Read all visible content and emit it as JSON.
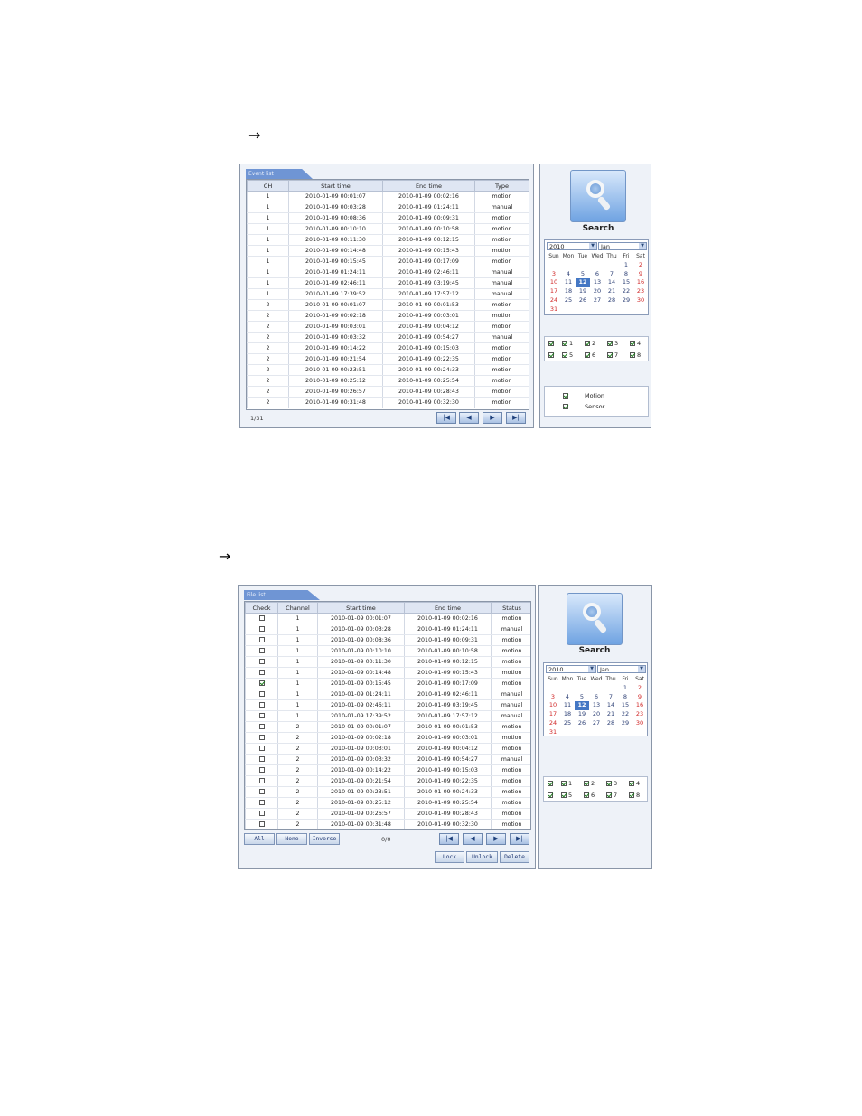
{
  "arrows": {
    "first": "→",
    "second": "→"
  },
  "event_panel": {
    "tab": "Event list",
    "columns": [
      "CH",
      "Start time",
      "End time",
      "Type"
    ],
    "rows": [
      [
        "1",
        "2010-01-09 00:01:07",
        "2010-01-09 00:02:16",
        "motion"
      ],
      [
        "1",
        "2010-01-09 00:03:28",
        "2010-01-09 01:24:11",
        "manual"
      ],
      [
        "1",
        "2010-01-09 00:08:36",
        "2010-01-09 00:09:31",
        "motion"
      ],
      [
        "1",
        "2010-01-09 00:10:10",
        "2010-01-09 00:10:58",
        "motion"
      ],
      [
        "1",
        "2010-01-09 00:11:30",
        "2010-01-09 00:12:15",
        "motion"
      ],
      [
        "1",
        "2010-01-09 00:14:48",
        "2010-01-09 00:15:43",
        "motion"
      ],
      [
        "1",
        "2010-01-09 00:15:45",
        "2010-01-09 00:17:09",
        "motion"
      ],
      [
        "1",
        "2010-01-09 01:24:11",
        "2010-01-09 02:46:11",
        "manual"
      ],
      [
        "1",
        "2010-01-09 02:46:11",
        "2010-01-09 03:19:45",
        "manual"
      ],
      [
        "1",
        "2010-01-09 17:39:52",
        "2010-01-09 17:57:12",
        "manual"
      ],
      [
        "2",
        "2010-01-09 00:01:07",
        "2010-01-09 00:01:53",
        "motion"
      ],
      [
        "2",
        "2010-01-09 00:02:18",
        "2010-01-09 00:03:01",
        "motion"
      ],
      [
        "2",
        "2010-01-09 00:03:01",
        "2010-01-09 00:04:12",
        "motion"
      ],
      [
        "2",
        "2010-01-09 00:03:32",
        "2010-01-09 00:54:27",
        "manual"
      ],
      [
        "2",
        "2010-01-09 00:14:22",
        "2010-01-09 00:15:03",
        "motion"
      ],
      [
        "2",
        "2010-01-09 00:21:54",
        "2010-01-09 00:22:35",
        "motion"
      ],
      [
        "2",
        "2010-01-09 00:23:51",
        "2010-01-09 00:24:33",
        "motion"
      ],
      [
        "2",
        "2010-01-09 00:25:12",
        "2010-01-09 00:25:54",
        "motion"
      ],
      [
        "2",
        "2010-01-09 00:26:57",
        "2010-01-09 00:28:43",
        "motion"
      ],
      [
        "2",
        "2010-01-09 00:31:48",
        "2010-01-09 00:32:30",
        "motion"
      ]
    ],
    "page": "1/31"
  },
  "file_panel": {
    "tab": "File list",
    "columns": [
      "Check",
      "Channel",
      "Start time",
      "End time",
      "Status"
    ],
    "rows": [
      [
        false,
        "1",
        "2010-01-09 00:01:07",
        "2010-01-09 00:02:16",
        "motion"
      ],
      [
        false,
        "1",
        "2010-01-09 00:03:28",
        "2010-01-09 01:24:11",
        "manual"
      ],
      [
        false,
        "1",
        "2010-01-09 00:08:36",
        "2010-01-09 00:09:31",
        "motion"
      ],
      [
        false,
        "1",
        "2010-01-09 00:10:10",
        "2010-01-09 00:10:58",
        "motion"
      ],
      [
        false,
        "1",
        "2010-01-09 00:11:30",
        "2010-01-09 00:12:15",
        "motion"
      ],
      [
        false,
        "1",
        "2010-01-09 00:14:48",
        "2010-01-09 00:15:43",
        "motion"
      ],
      [
        true,
        "1",
        "2010-01-09 00:15:45",
        "2010-01-09 00:17:09",
        "motion"
      ],
      [
        false,
        "1",
        "2010-01-09 01:24:11",
        "2010-01-09 02:46:11",
        "manual"
      ],
      [
        false,
        "1",
        "2010-01-09 02:46:11",
        "2010-01-09 03:19:45",
        "manual"
      ],
      [
        false,
        "1",
        "2010-01-09 17:39:52",
        "2010-01-09 17:57:12",
        "manual"
      ],
      [
        false,
        "2",
        "2010-01-09 00:01:07",
        "2010-01-09 00:01:53",
        "motion"
      ],
      [
        false,
        "2",
        "2010-01-09 00:02:18",
        "2010-01-09 00:03:01",
        "motion"
      ],
      [
        false,
        "2",
        "2010-01-09 00:03:01",
        "2010-01-09 00:04:12",
        "motion"
      ],
      [
        false,
        "2",
        "2010-01-09 00:03:32",
        "2010-01-09 00:54:27",
        "manual"
      ],
      [
        false,
        "2",
        "2010-01-09 00:14:22",
        "2010-01-09 00:15:03",
        "motion"
      ],
      [
        false,
        "2",
        "2010-01-09 00:21:54",
        "2010-01-09 00:22:35",
        "motion"
      ],
      [
        false,
        "2",
        "2010-01-09 00:23:51",
        "2010-01-09 00:24:33",
        "motion"
      ],
      [
        false,
        "2",
        "2010-01-09 00:25:12",
        "2010-01-09 00:25:54",
        "motion"
      ],
      [
        false,
        "2",
        "2010-01-09 00:26:57",
        "2010-01-09 00:28:43",
        "motion"
      ],
      [
        false,
        "2",
        "2010-01-09 00:31:48",
        "2010-01-09 00:32:30",
        "motion"
      ]
    ],
    "count": "0/0",
    "buttons": {
      "all": "All",
      "none": "None",
      "inverse": "Inverse",
      "lock": "Lock",
      "unlock": "Unlock",
      "delete": "Delete"
    }
  },
  "nav": {
    "first": "|◀",
    "prev": "◀",
    "next": "▶",
    "last": "▶|"
  },
  "search": {
    "label": "Search",
    "year": "2010",
    "month": "Jan",
    "weekdays": [
      "Sun",
      "Mon",
      "Tue",
      "Wed",
      "Thu",
      "Fri",
      "Sat"
    ],
    "weeks": [
      [
        "",
        "",
        "",
        "",
        "",
        "1",
        "2"
      ],
      [
        "3",
        "4",
        "5",
        "6",
        "7",
        "8",
        "9"
      ],
      [
        "10",
        "11",
        "12",
        "13",
        "14",
        "15",
        "16"
      ],
      [
        "17",
        "18",
        "19",
        "20",
        "21",
        "22",
        "23"
      ],
      [
        "24",
        "25",
        "26",
        "27",
        "28",
        "29",
        "30"
      ],
      [
        "31",
        "",
        "",
        "",
        "",
        "",
        ""
      ]
    ],
    "selected_day": "12",
    "channels": [
      "1",
      "2",
      "3",
      "4",
      "5",
      "6",
      "7",
      "8"
    ],
    "types": [
      "Motion",
      "Sensor"
    ]
  },
  "colors": {
    "accent": "#4477c4",
    "weekend": "#d02626",
    "panel": "#eef2f8"
  }
}
